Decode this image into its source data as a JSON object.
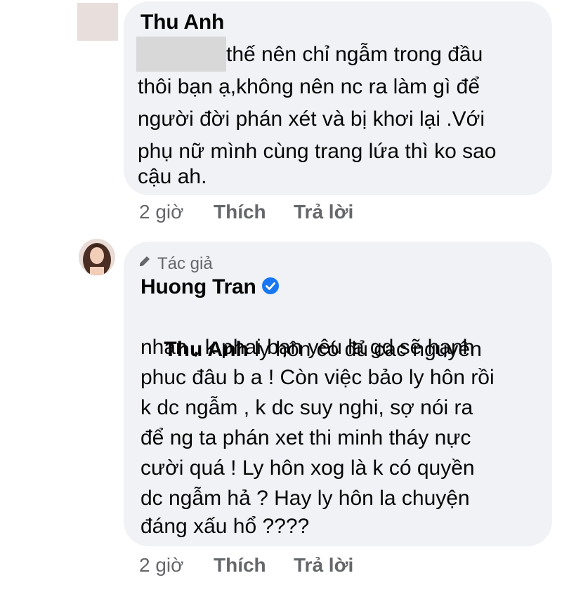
{
  "comment1": {
    "author": "Thu Anh",
    "lines": [
      "thế nên chỉ ngẫm trong đầu",
      "thôi bạn ạ,không nên nc ra làm gì để",
      "người đời phán xét và bị khơi lại .Với",
      "phụ nữ mình cùng trang lứa thì ko sao",
      "cậu ah."
    ],
    "time": "2 giờ",
    "like": "Thích",
    "reply": "Trả lời"
  },
  "comment2": {
    "author_tag": "Tác giả",
    "author": "Huong Tran",
    "mention": "Thu Anh",
    "first_line_rest": " ly hôn có đủ cac nguyên",
    "lines": [
      "nhan , k phai bạn yêu la gd sẽ hạnh",
      "phuc đâu b a ! Còn việc bảo ly hôn rồi",
      "k dc ngẫm , k dc suy nghi, sợ nói ra",
      "để ng ta phán xet thi minh tháy nực",
      "cười quá ! Ly hôn xog là k có quyền",
      "dc ngẫm hả ? Hay ly hôn la chuyện",
      "đáng xấu hổ ????"
    ],
    "time": "2 giờ",
    "like": "Thích",
    "reply": "Trả lời"
  },
  "colors": {
    "bubble": "#f0f2f5",
    "meta": "#65676b",
    "verified": "#1877f2"
  }
}
